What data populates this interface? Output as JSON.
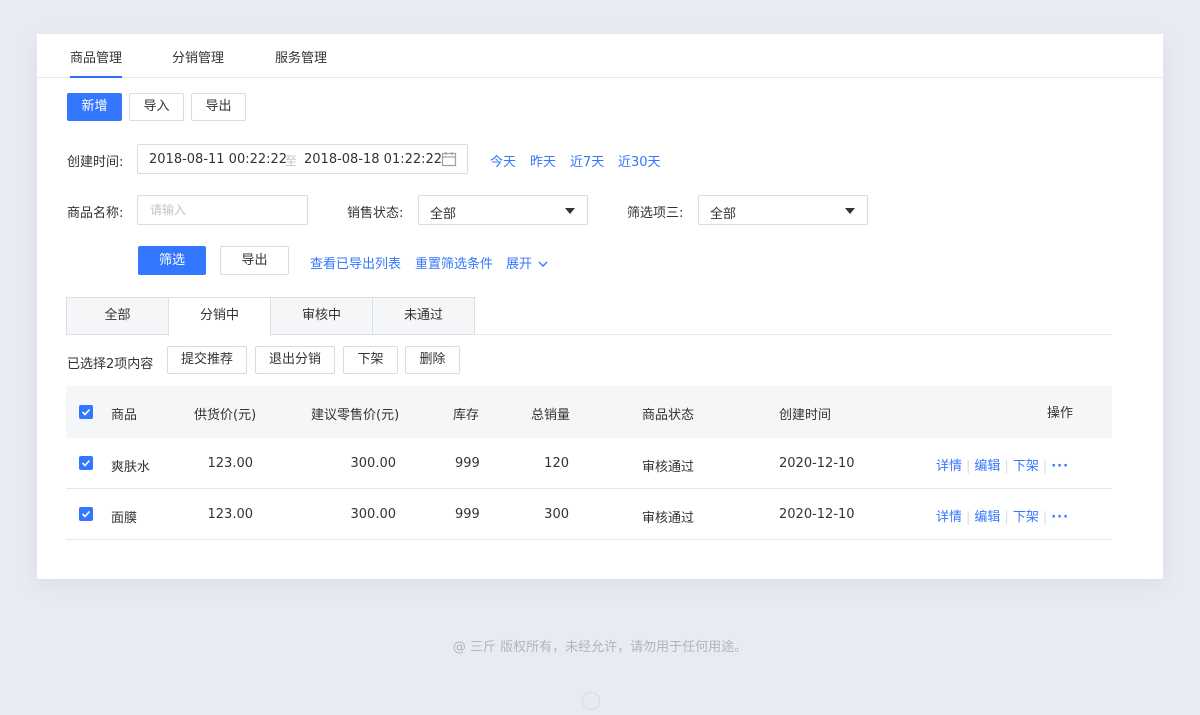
{
  "nav": {
    "items": [
      "商品管理",
      "分销管理",
      "服务管理"
    ],
    "active": 0
  },
  "toolbar": {
    "add": "新增",
    "import": "导入",
    "export": "导出"
  },
  "filters": {
    "created_label": "创建时间:",
    "date_start": "2018-08-11 00:22:22",
    "date_to": "至",
    "date_end": "2018-08-18 01:22:22",
    "quick": [
      "今天",
      "昨天",
      "近7天",
      "近30天"
    ],
    "name_label": "商品名称:",
    "name_placeholder": "请输入",
    "sale_status_label": "销售状态:",
    "sale_status_value": "全部",
    "filter3_label": "筛选项三:",
    "filter3_value": "全部",
    "filter_btn": "筛选",
    "export_btn": "导出",
    "view_exported": "查看已导出列表",
    "reset": "重置筛选条件",
    "expand": "展开"
  },
  "status_tabs": {
    "items": [
      "全部",
      "分销中",
      "审核中",
      "未通过"
    ],
    "active": 1
  },
  "batch": {
    "selected_text": "已选择2项内容",
    "submit_recommend": "提交推荐",
    "exit_distribution": "退出分销",
    "take_down": "下架",
    "delete": "删除"
  },
  "table": {
    "headers": [
      "商品",
      "供货价(元)",
      "建议零售价(元)",
      "库存",
      "总销量",
      "商品状态",
      "创建时间",
      "操作"
    ],
    "rows": [
      {
        "name": "爽肤水",
        "supply_price": "123.00",
        "retail_price": "300.00",
        "stock": "999",
        "sales": "120",
        "status": "审核通过",
        "created": "2020-12-10"
      },
      {
        "name": "面膜",
        "supply_price": "123.00",
        "retail_price": "300.00",
        "stock": "999",
        "sales": "300",
        "status": "审核通过",
        "created": "2020-12-10"
      }
    ],
    "ops": [
      "详情",
      "编辑",
      "下架"
    ],
    "more": "···"
  },
  "footer": "@ 三斤  版权所有，未经允许，请勿用于任何用途。",
  "colors": {
    "accent": "#3377ff",
    "background": "#e8ebf2"
  }
}
